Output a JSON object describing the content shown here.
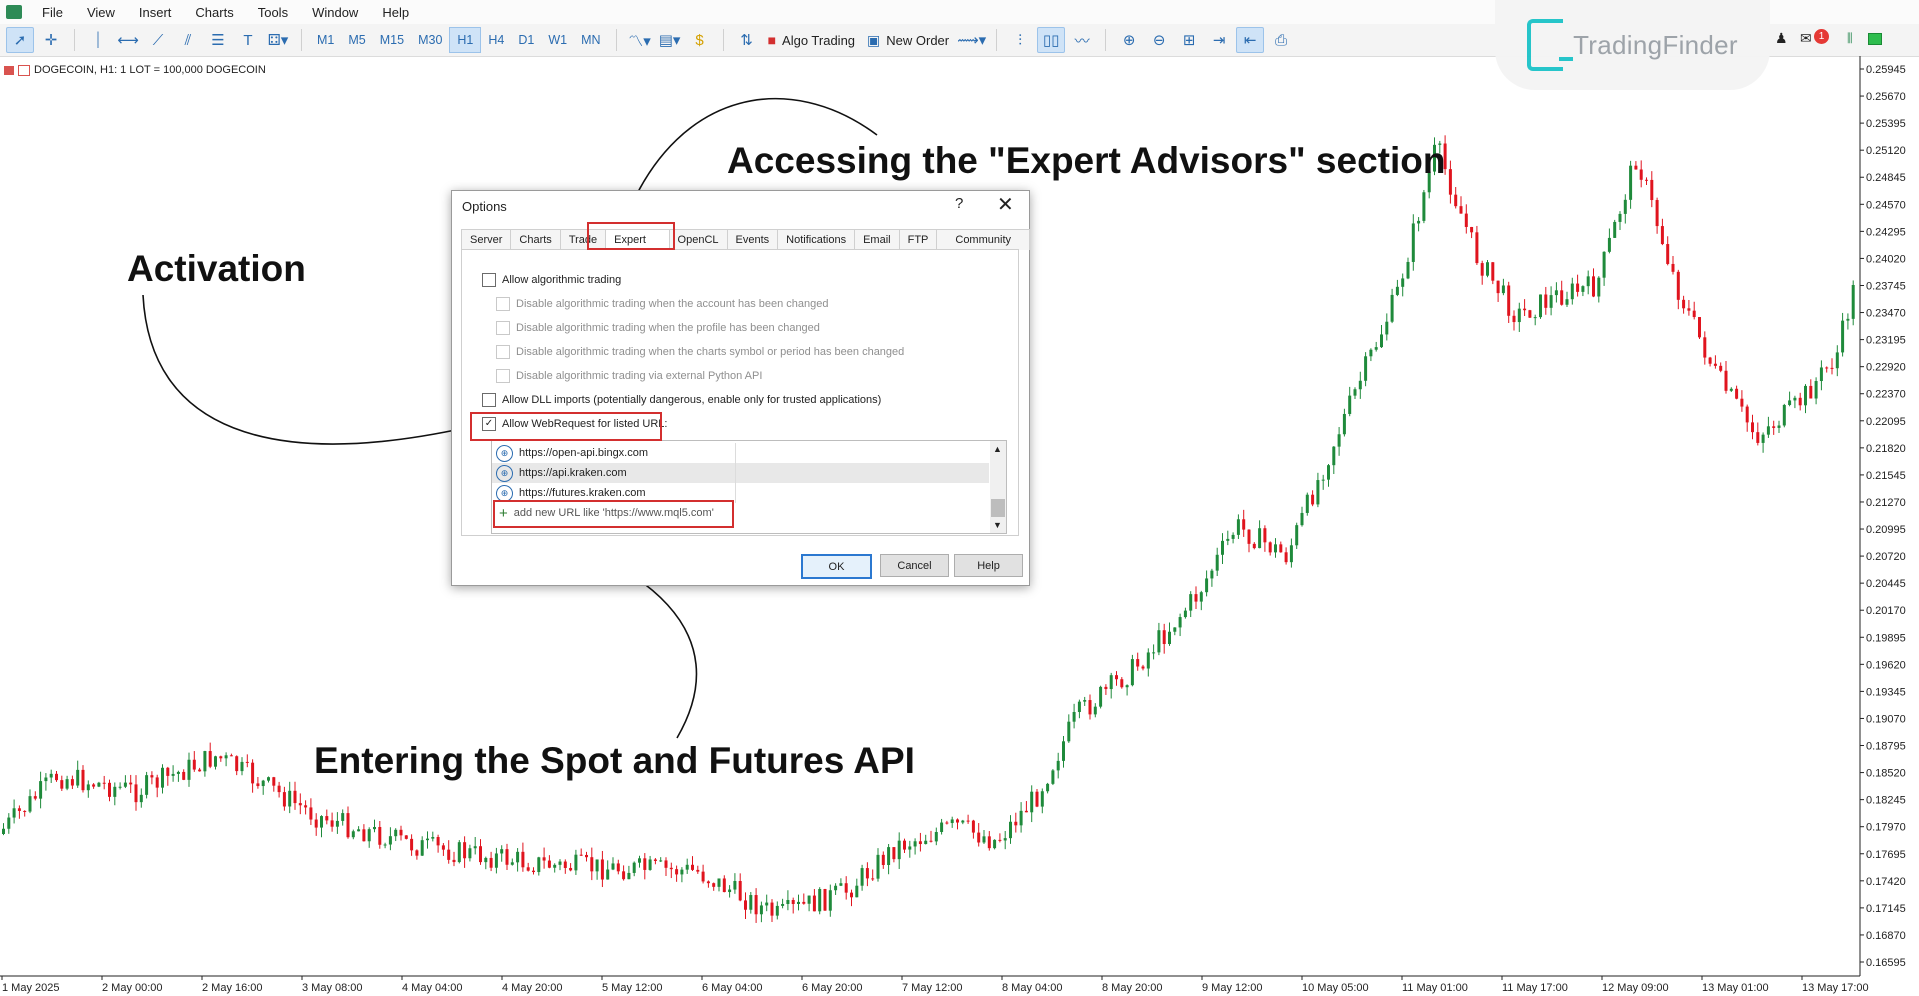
{
  "menu": [
    "File",
    "View",
    "Insert",
    "Charts",
    "Tools",
    "Window",
    "Help"
  ],
  "toolbar": {
    "timeframes": [
      "M1",
      "M5",
      "M15",
      "M30",
      "H1",
      "H4",
      "D1",
      "W1",
      "MN"
    ],
    "active_timeframe": "H1",
    "algo_trading_label": "Algo Trading",
    "new_order_label": "New Order",
    "notification_count": "1"
  },
  "watermark": {
    "brand": "TradingFinder"
  },
  "chart": {
    "header": "DOGECOIN, H1:  1 LOT = 100,000 DOGECOIN",
    "price_ticks": [
      "0.25945",
      "0.25670",
      "0.25395",
      "0.25120",
      "0.24845",
      "0.24570",
      "0.24295",
      "0.24020",
      "0.23745",
      "0.23470",
      "0.23195",
      "0.22920",
      "0.22370",
      "0.22095",
      "0.21820",
      "0.21545",
      "0.21270",
      "0.20995",
      "0.20720",
      "0.20445",
      "0.20170",
      "0.19895",
      "0.19620",
      "0.19345",
      "0.19070",
      "0.18795",
      "0.18520",
      "0.18245",
      "0.17970",
      "0.17695",
      "0.17420",
      "0.17145",
      "0.16870",
      "0.16595"
    ],
    "time_ticks": [
      "1 May 2025",
      "2 May 00:00",
      "2 May 16:00",
      "3 May 08:00",
      "4 May 04:00",
      "4 May 20:00",
      "5 May 12:00",
      "6 May 04:00",
      "6 May 20:00",
      "7 May 12:00",
      "8 May 04:00",
      "8 May 20:00",
      "9 May 12:00",
      "10 May 05:00",
      "11 May 01:00",
      "11 May 17:00",
      "12 May 09:00",
      "13 May 01:00",
      "13 May 17:00"
    ],
    "colors": {
      "bull": "#1f8a3b",
      "bear": "#e0141e",
      "axis": "#222222"
    }
  },
  "annotations": {
    "expert_advisors": "Accessing the \"Expert Advisors\" section",
    "activation": "Activation",
    "api": "Entering the Spot and Futures API"
  },
  "dialog": {
    "title": "Options",
    "help_symbol": "?",
    "close_symbol": "✕",
    "tabs": [
      "Server",
      "Charts",
      "Trade",
      "Expert Advisors",
      "OpenCL",
      "Events",
      "Notifications",
      "Email",
      "FTP",
      "Community"
    ],
    "active_tab": "Expert Advisors",
    "options": [
      {
        "label": "Allow algorithmic trading",
        "checked": false,
        "enabled": true
      },
      {
        "label": "Disable algorithmic trading when the account has been changed",
        "checked": false,
        "enabled": false
      },
      {
        "label": "Disable algorithmic trading when the profile has been changed",
        "checked": false,
        "enabled": false
      },
      {
        "label": "Disable algorithmic trading when the charts symbol or period has been changed",
        "checked": false,
        "enabled": false
      },
      {
        "label": "Disable algorithmic trading via external Python API",
        "checked": false,
        "enabled": false
      },
      {
        "label": "Allow DLL imports (potentially dangerous, enable only for trusted applications)",
        "checked": false,
        "enabled": true
      },
      {
        "label": "Allow WebRequest for listed URL:",
        "checked": true,
        "enabled": true
      }
    ],
    "urls": [
      "https://open-api.bingx.com",
      "https://api.kraken.com",
      "https://futures.kraken.com"
    ],
    "add_url_placeholder": "add new URL like 'https://www.mql5.com'",
    "buttons": {
      "ok": "OK",
      "cancel": "Cancel",
      "help": "Help"
    }
  }
}
